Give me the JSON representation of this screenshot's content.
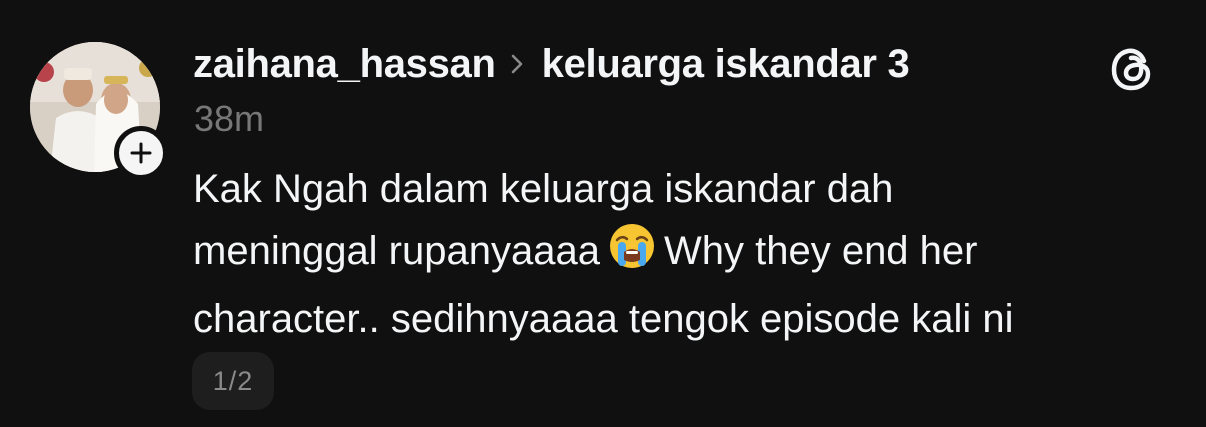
{
  "post": {
    "author": "zaihana_hassan",
    "community": "keluarga iskandar 3",
    "time_ago": "38m",
    "text_line1": "Kak Ngah dalam keluarga iskandar dah",
    "text_line2_a": "meninggal rupanyaaaa",
    "text_line2_emoji": "loudly-crying-face-emoji",
    "text_line2_b": "Why they end her",
    "text_line3": "character.. sedihnyaaaa tengok episode kali ni",
    "media_pager": "1/2"
  },
  "icons": {
    "follow": "plus-icon",
    "separator": "chevron-right-icon",
    "brand": "threads-logo-icon"
  },
  "colors": {
    "background": "#101010",
    "text_primary": "#f3f5f7",
    "text_secondary": "#777777",
    "pager_bg": "#1e1e1e"
  }
}
